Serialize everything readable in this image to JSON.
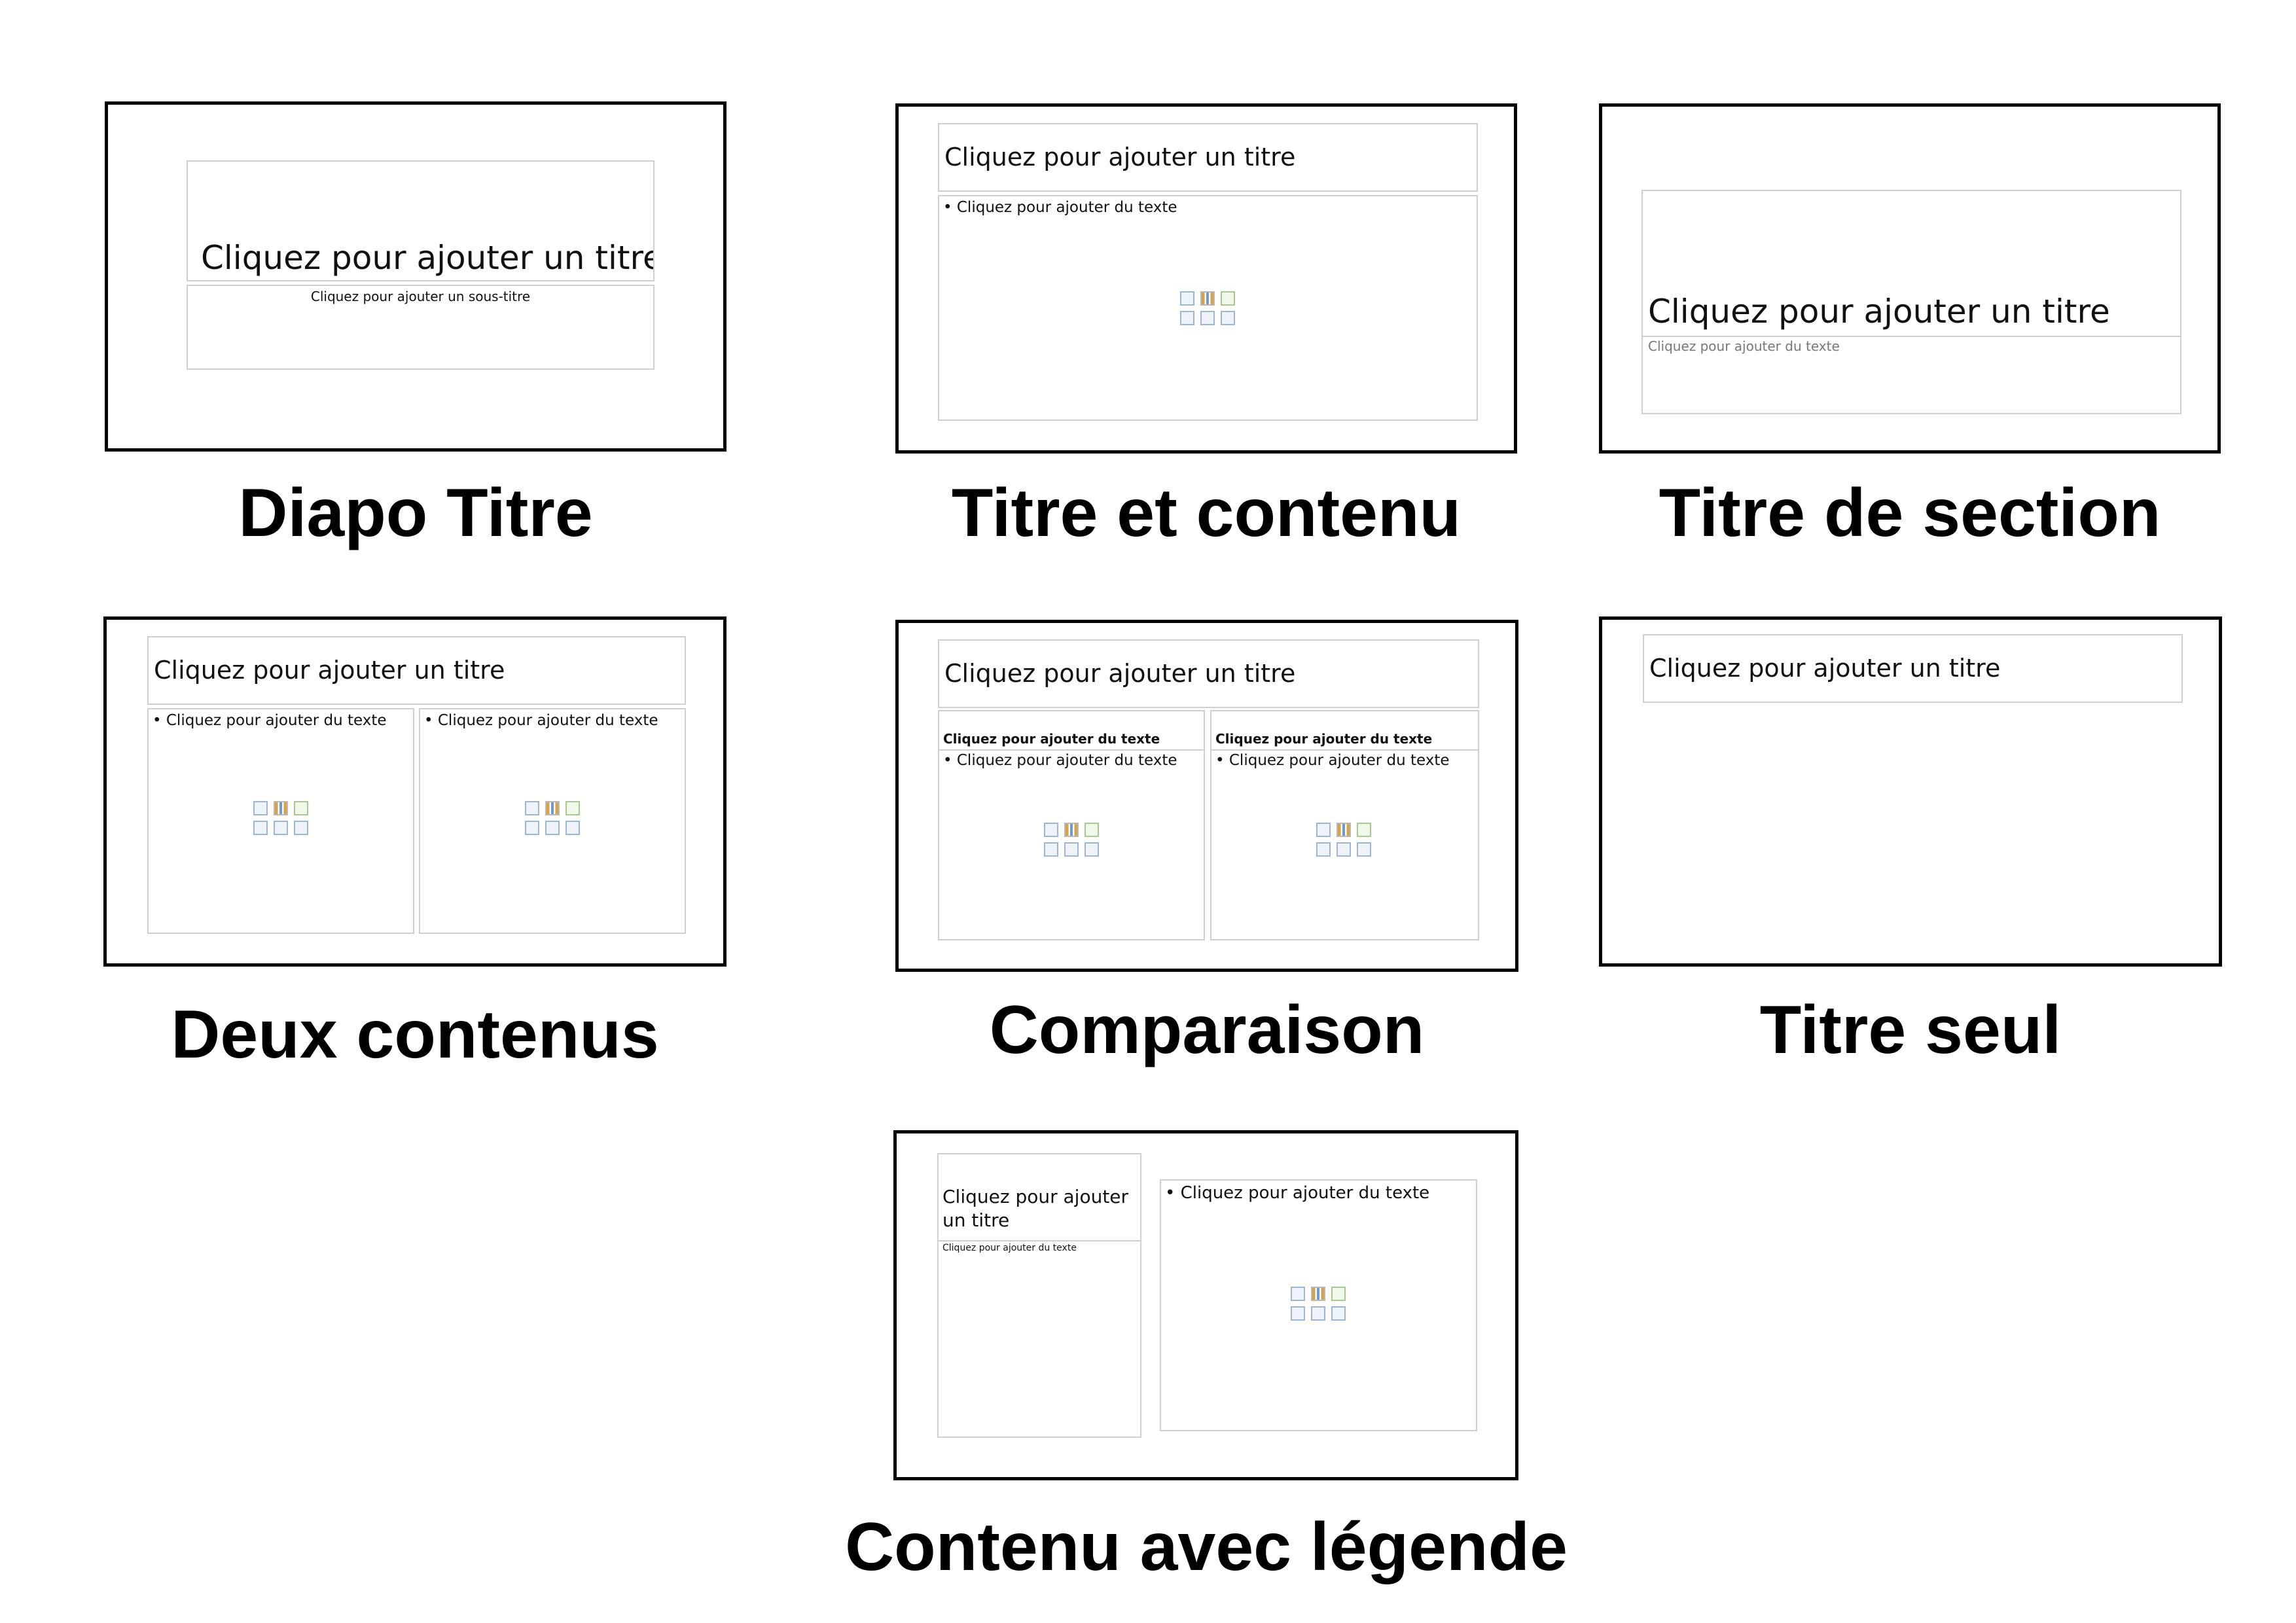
{
  "placeholders": {
    "title": "Cliquez pour ajouter un titre",
    "title_line1": "Cliquez pour ajouter",
    "title_line2": "un titre",
    "subtitle": "Cliquez pour ajouter un sous-titre",
    "text": "Cliquez pour ajouter du texte",
    "bullet_text": "• Cliquez pour ajouter du texte"
  },
  "layouts": [
    {
      "name": "Diapo Titre"
    },
    {
      "name": "Titre et contenu"
    },
    {
      "name": "Titre de section"
    },
    {
      "name": "Deux contenus"
    },
    {
      "name": "Comparaison"
    },
    {
      "name": "Titre seul"
    },
    {
      "name": "Contenu avec légende"
    }
  ],
  "icons": [
    "table-icon",
    "chart-icon",
    "smartart-icon",
    "picture-icon",
    "online-picture-icon",
    "video-icon"
  ],
  "colors": {
    "border": "#000000",
    "placeholder_border": "#cfcfcf",
    "caption": "#000000"
  }
}
